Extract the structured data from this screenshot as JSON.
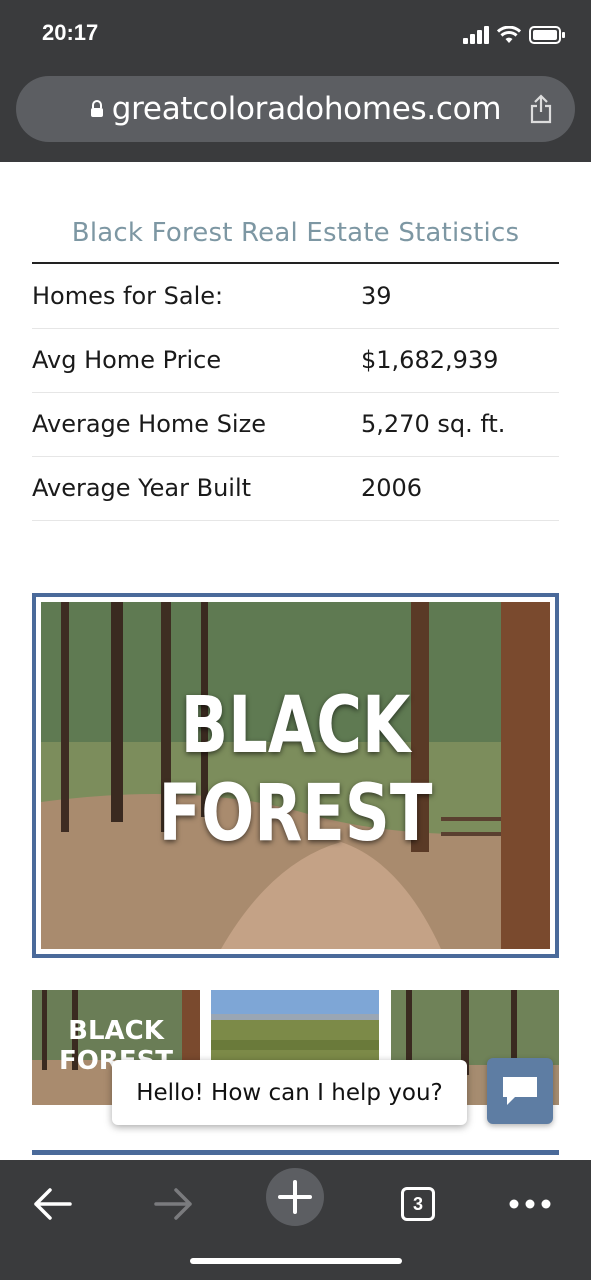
{
  "status_bar": {
    "time": "20:17"
  },
  "browser": {
    "url": "greatcoloradohomes.com",
    "tab_count": "3"
  },
  "stats": {
    "title": "Black Forest Real Estate Statistics",
    "rows": [
      {
        "label": "Homes for Sale:",
        "value": "39"
      },
      {
        "label": "Avg Home Price",
        "value": "$1,682,939"
      },
      {
        "label": "Average Home Size",
        "value": "5,270 sq. ft."
      },
      {
        "label": "Average Year Built",
        "value": "2006"
      }
    ]
  },
  "hero": {
    "line1": "BLACK",
    "line2": "FOREST"
  },
  "thumbnails": [
    {
      "line1": "BLACK",
      "line2": "FOREST"
    }
  ],
  "chat": {
    "greeting": "Hello! How can I help you?"
  },
  "colors": {
    "accent": "#4a6a9a",
    "title": "#7d97a3",
    "chrome": "#3a3b3d"
  }
}
